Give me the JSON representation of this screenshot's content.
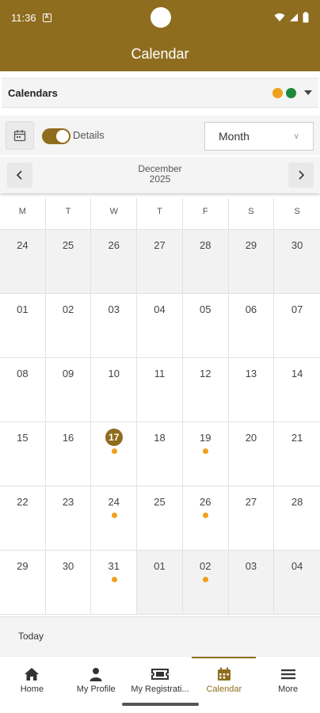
{
  "status_bar": {
    "time": "11:36",
    "sim_label": "A"
  },
  "header": {
    "title": "Calendar"
  },
  "calendars": {
    "label": "Calendars",
    "colors": [
      "#f0a11a",
      "#1f8a3a"
    ]
  },
  "controls": {
    "details_label": "Details",
    "details_on": true,
    "view": "Month"
  },
  "month_nav": {
    "month": "December",
    "year": "2025"
  },
  "weekdays": [
    "M",
    "T",
    "W",
    "T",
    "F",
    "S",
    "S"
  ],
  "weeks": [
    [
      {
        "d": "24",
        "other": true
      },
      {
        "d": "25",
        "other": true
      },
      {
        "d": "26",
        "other": true
      },
      {
        "d": "27",
        "other": true
      },
      {
        "d": "28",
        "other": true
      },
      {
        "d": "29",
        "other": true
      },
      {
        "d": "30",
        "other": true
      }
    ],
    [
      {
        "d": "01"
      },
      {
        "d": "02"
      },
      {
        "d": "03"
      },
      {
        "d": "04"
      },
      {
        "d": "05"
      },
      {
        "d": "06"
      },
      {
        "d": "07"
      }
    ],
    [
      {
        "d": "08"
      },
      {
        "d": "09"
      },
      {
        "d": "10"
      },
      {
        "d": "11"
      },
      {
        "d": "12"
      },
      {
        "d": "13"
      },
      {
        "d": "14"
      }
    ],
    [
      {
        "d": "15"
      },
      {
        "d": "16"
      },
      {
        "d": "17",
        "today": true,
        "event": true
      },
      {
        "d": "18"
      },
      {
        "d": "19",
        "event": true
      },
      {
        "d": "20"
      },
      {
        "d": "21"
      }
    ],
    [
      {
        "d": "22"
      },
      {
        "d": "23"
      },
      {
        "d": "24",
        "event": true
      },
      {
        "d": "25"
      },
      {
        "d": "26",
        "event": true
      },
      {
        "d": "27"
      },
      {
        "d": "28"
      }
    ],
    [
      {
        "d": "29"
      },
      {
        "d": "30"
      },
      {
        "d": "31",
        "event": true
      },
      {
        "d": "01",
        "other": true
      },
      {
        "d": "02",
        "other": true,
        "event": true
      },
      {
        "d": "03",
        "other": true
      },
      {
        "d": "04",
        "other": true
      }
    ]
  ],
  "today_bar": {
    "label": "Today"
  },
  "bottom_nav": [
    {
      "label": "Home",
      "icon": "home-icon"
    },
    {
      "label": "My Profile",
      "icon": "person-icon"
    },
    {
      "label": "My Registrati...",
      "icon": "ticket-icon"
    },
    {
      "label": "Calendar",
      "icon": "calendar-icon",
      "active": true
    },
    {
      "label": "More",
      "icon": "menu-icon"
    }
  ]
}
